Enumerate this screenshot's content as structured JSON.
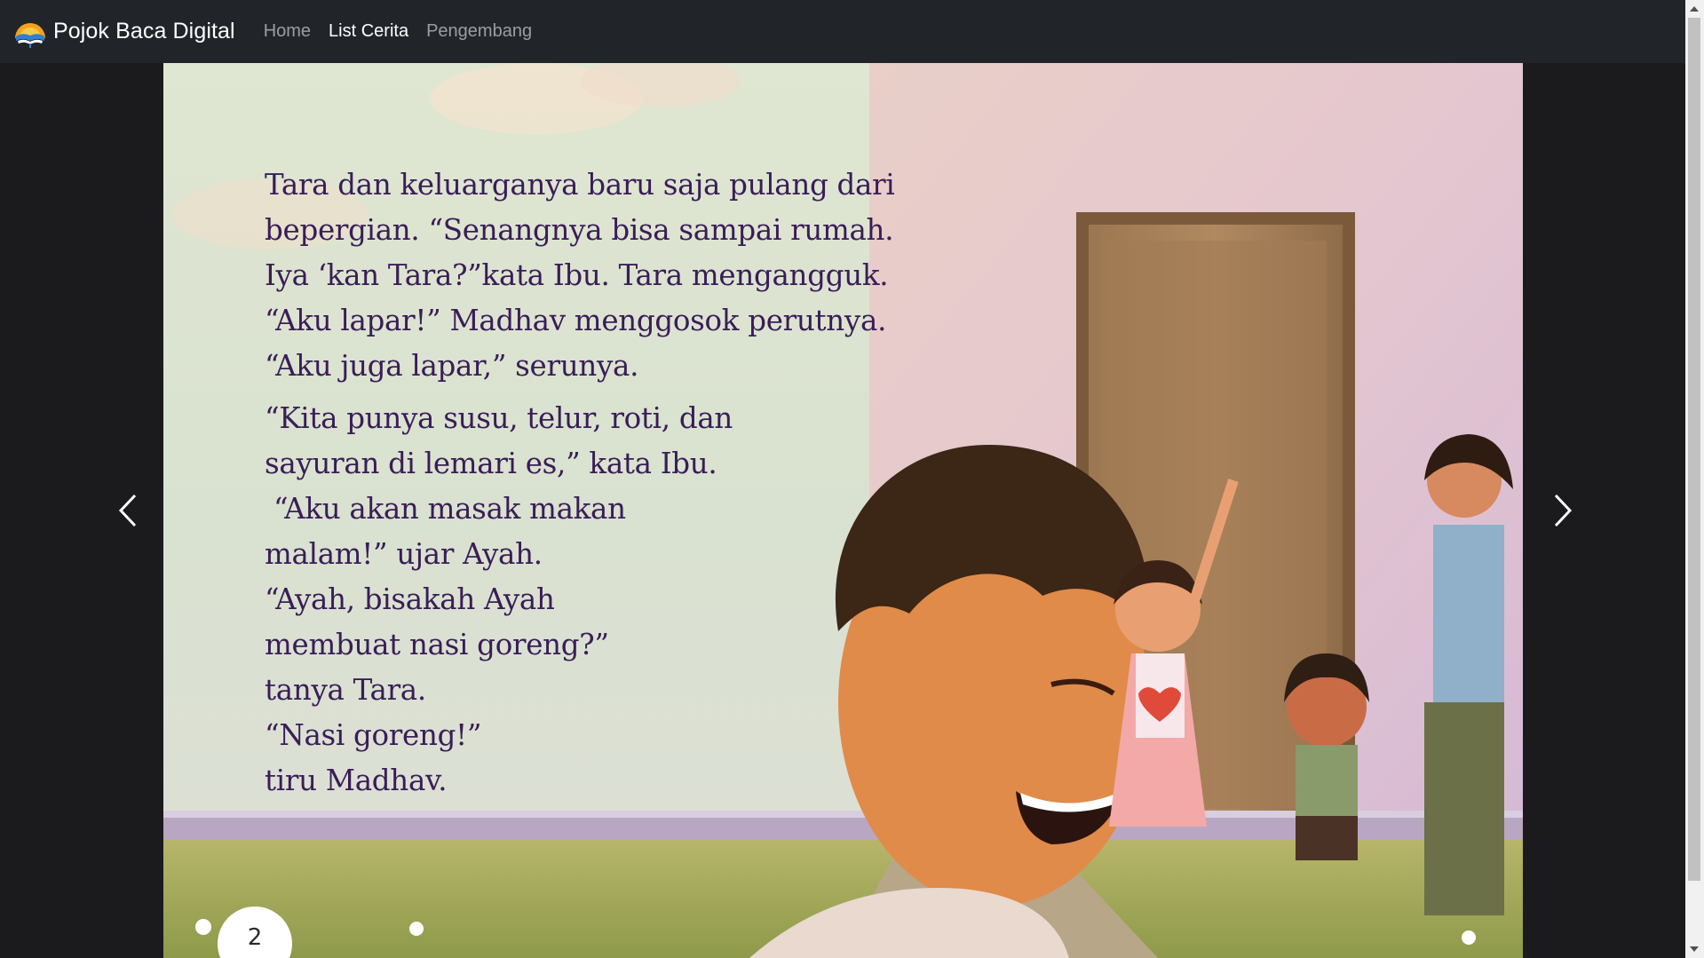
{
  "navbar": {
    "brand": "Pojok Baca Digital",
    "brand_logo_icon": "book-sunrise-logo",
    "links": [
      {
        "label": "Home",
        "active": false
      },
      {
        "label": "List Cerita",
        "active": true
      },
      {
        "label": "Pengembang",
        "active": false
      }
    ]
  },
  "story_page": {
    "paragraph1": [
      "Tara dan keluarganya baru saja pulang dari",
      "bepergian. “Senangnya bisa sampai rumah.",
      "Iya ‘kan Tara?”kata Ibu. Tara mengangguk.",
      "“Aku lapar!” Madhav menggosok perutnya.",
      "“Aku juga lapar,” serunya."
    ],
    "paragraph2": [
      "“Kita punya susu, telur, roti, dan",
      "sayuran di lemari es,” kata Ibu.",
      " “Aku akan masak makan",
      "malam!” ujar Ayah.",
      "“Ayah, bisakah Ayah",
      "membuat nasi goreng?”",
      "tanya Tara.",
      "“Nasi goreng!”",
      "tiru Madhav."
    ],
    "page_number": "2"
  },
  "carousel": {
    "prev_icon": "chevron-left-icon",
    "next_icon": "chevron-right-icon"
  },
  "colors": {
    "navbar_bg": "#212529",
    "page_bg": "#1b1b1d",
    "story_text": "#3a1d57"
  }
}
